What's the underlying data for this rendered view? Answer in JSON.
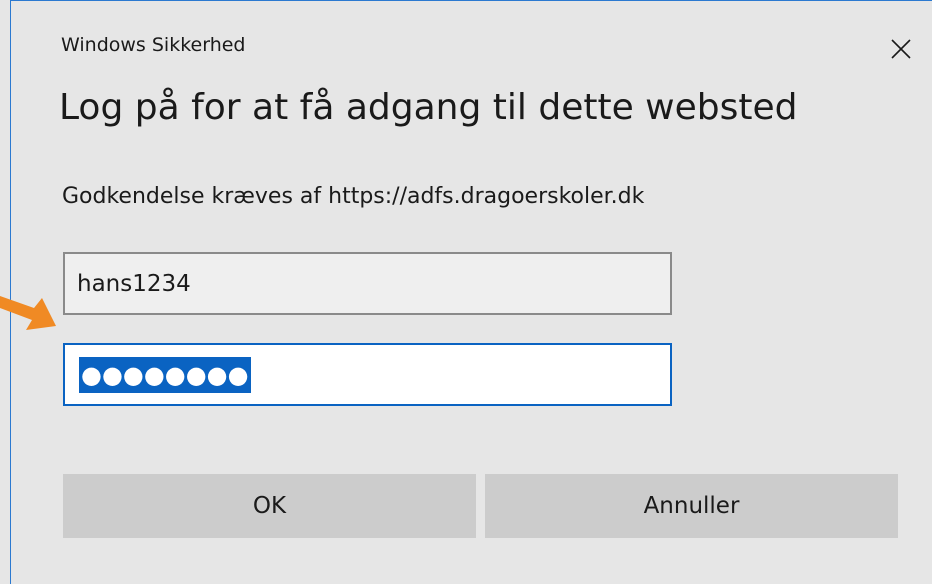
{
  "window": {
    "title": "Windows Sikkerhed",
    "close_icon": "close-icon"
  },
  "heading": "Log på for at få adgang til dette websted",
  "auth_message": "Godkendelse kræves af https://adfs.dragoerskoler.dk",
  "username_field": {
    "value": "hans1234"
  },
  "password_field": {
    "value": "●●●●●●●●",
    "selected": true
  },
  "buttons": {
    "ok_label": "OK",
    "cancel_label": "Annuller"
  },
  "annotation": {
    "arrow_icon": "arrow-icon",
    "arrow_color": "#f08a24"
  },
  "colors": {
    "accent": "#0a63c2",
    "dialog_background": "#e6e6e6",
    "button_background": "#cccccc"
  }
}
